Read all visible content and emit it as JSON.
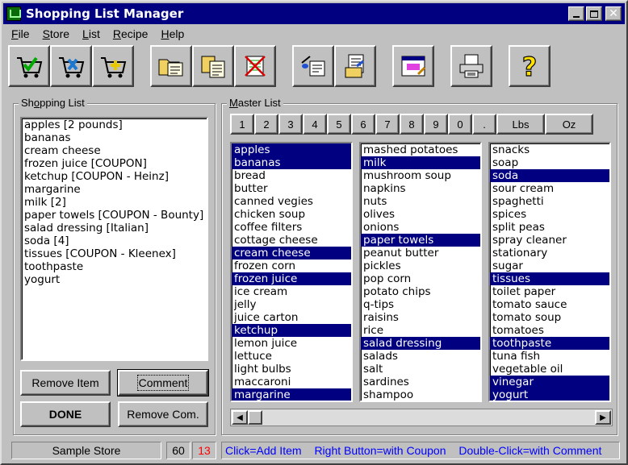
{
  "window": {
    "title": "Shopping List Manager"
  },
  "menu": [
    {
      "label": "File",
      "key": "F",
      "rest": "ile"
    },
    {
      "label": "Store",
      "key": "S",
      "rest": "tore"
    },
    {
      "label": "List",
      "key": "L",
      "rest": "ist"
    },
    {
      "label": "Recipe",
      "key": "R",
      "rest": "ecipe"
    },
    {
      "label": "Help",
      "key": "H",
      "rest": "elp"
    }
  ],
  "toolbar": [
    {
      "name": "cart-check-icon"
    },
    {
      "name": "cart-tools-icon"
    },
    {
      "name": "cart-add-icon"
    },
    {
      "name": "open-list-icon"
    },
    {
      "name": "copy-list-icon"
    },
    {
      "name": "delete-list-icon"
    },
    {
      "name": "recipe-icon"
    },
    {
      "name": "recipe-list-icon"
    },
    {
      "name": "window-edit-icon"
    },
    {
      "name": "print-icon"
    },
    {
      "name": "help-icon"
    }
  ],
  "shopping": {
    "label_pre": "Sh",
    "label_key": "o",
    "label_post": "pping List",
    "items": [
      "apples [2 pounds]",
      "bananas",
      "cream cheese",
      "frozen juice [COUPON]",
      "ketchup [COUPON - Heinz]",
      "margarine",
      "milk [2]",
      "paper towels [COUPON - Bounty]",
      "salad dressing [Italian]",
      "soda [4]",
      "tissues [COUPON - Kleenex]",
      "toothpaste",
      "yogurt"
    ],
    "buttons": {
      "remove_item": "Remove Item",
      "comment": "Comment",
      "done": "DONE",
      "remove_comment": "Remove Com."
    }
  },
  "master": {
    "label_key": "M",
    "label_post": "aster List",
    "keypad": [
      "1",
      "2",
      "3",
      "4",
      "5",
      "6",
      "7",
      "8",
      "9",
      "0",
      ".",
      "Lbs",
      "Oz"
    ],
    "columns": [
      [
        {
          "text": "apples",
          "selected": true
        },
        {
          "text": "bananas",
          "selected": true
        },
        {
          "text": "bread",
          "selected": false
        },
        {
          "text": "butter",
          "selected": false
        },
        {
          "text": "canned vegies",
          "selected": false
        },
        {
          "text": "chicken soup",
          "selected": false
        },
        {
          "text": "coffee filters",
          "selected": false
        },
        {
          "text": "cottage cheese",
          "selected": false
        },
        {
          "text": "cream cheese",
          "selected": true
        },
        {
          "text": "frozen corn",
          "selected": false
        },
        {
          "text": "frozen juice",
          "selected": true
        },
        {
          "text": "ice cream",
          "selected": false
        },
        {
          "text": "jelly",
          "selected": false
        },
        {
          "text": "juice carton",
          "selected": false
        },
        {
          "text": "ketchup",
          "selected": true
        },
        {
          "text": "lemon juice",
          "selected": false
        },
        {
          "text": "lettuce",
          "selected": false
        },
        {
          "text": "light bulbs",
          "selected": false
        },
        {
          "text": "maccaroni",
          "selected": false
        },
        {
          "text": "margarine",
          "selected": true
        }
      ],
      [
        {
          "text": "mashed potatoes",
          "selected": false
        },
        {
          "text": "milk",
          "selected": true
        },
        {
          "text": "mushroom soup",
          "selected": false
        },
        {
          "text": "napkins",
          "selected": false
        },
        {
          "text": "nuts",
          "selected": false
        },
        {
          "text": "olives",
          "selected": false
        },
        {
          "text": "onions",
          "selected": false
        },
        {
          "text": "paper towels",
          "selected": true
        },
        {
          "text": "peanut butter",
          "selected": false
        },
        {
          "text": "pickles",
          "selected": false
        },
        {
          "text": "pop corn",
          "selected": false
        },
        {
          "text": "potato chips",
          "selected": false
        },
        {
          "text": "q-tips",
          "selected": false
        },
        {
          "text": "raisins",
          "selected": false
        },
        {
          "text": "rice",
          "selected": false
        },
        {
          "text": "salad dressing",
          "selected": true
        },
        {
          "text": "salads",
          "selected": false
        },
        {
          "text": "salt",
          "selected": false
        },
        {
          "text": "sardines",
          "selected": false
        },
        {
          "text": "shampoo",
          "selected": false
        }
      ],
      [
        {
          "text": "snacks",
          "selected": false
        },
        {
          "text": "soap",
          "selected": false
        },
        {
          "text": "soda",
          "selected": true
        },
        {
          "text": "sour cream",
          "selected": false
        },
        {
          "text": "spaghetti",
          "selected": false
        },
        {
          "text": "spices",
          "selected": false
        },
        {
          "text": "split peas",
          "selected": false
        },
        {
          "text": "spray cleaner",
          "selected": false
        },
        {
          "text": "stationary",
          "selected": false
        },
        {
          "text": "sugar",
          "selected": false
        },
        {
          "text": "tissues",
          "selected": true
        },
        {
          "text": "toilet paper",
          "selected": false
        },
        {
          "text": "tomato sauce",
          "selected": false
        },
        {
          "text": "tomato soup",
          "selected": false
        },
        {
          "text": "tomatoes",
          "selected": false
        },
        {
          "text": "toothpaste",
          "selected": true
        },
        {
          "text": "tuna fish",
          "selected": false
        },
        {
          "text": "vegetable oil",
          "selected": false
        },
        {
          "text": "vinegar",
          "selected": true
        },
        {
          "text": "yogurt",
          "selected": true
        }
      ]
    ]
  },
  "status": {
    "store": "Sample Store",
    "count_total": "60",
    "count_selected": "13",
    "hints": [
      "Click=Add Item",
      "Right Button=with Coupon",
      "Double-Click=with Comment"
    ]
  },
  "colors": {
    "selection": "#000080",
    "hint": "#0000ff",
    "count_selected": "#ff0000"
  }
}
